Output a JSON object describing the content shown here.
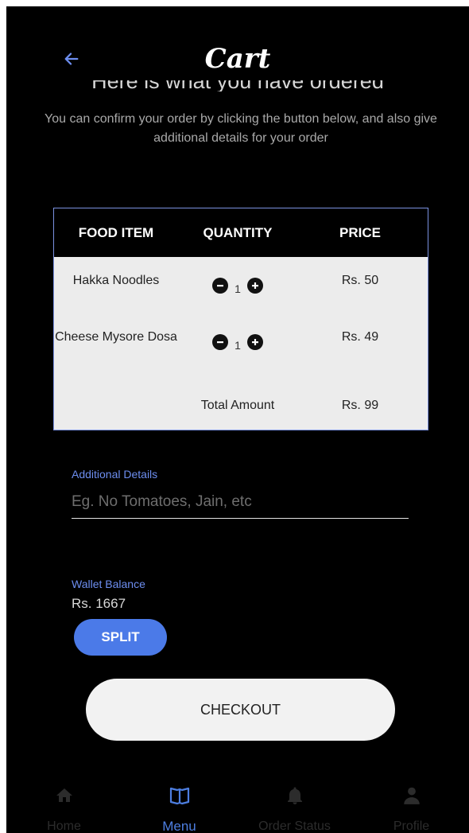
{
  "header": {
    "title": "Cart",
    "back_icon": "arrow-left-icon",
    "heading": "Here is what you have ordered",
    "subtitle": "You can confirm your order by clicking the button below, and also give additional details for your order"
  },
  "table": {
    "columns": [
      "FOOD ITEM",
      "QUANTITY",
      "PRICE"
    ],
    "rows": [
      {
        "name": "Hakka Noodles",
        "quantity": "1",
        "price": "Rs. 50"
      },
      {
        "name": "Cheese Mysore Dosa",
        "quantity": "1",
        "price": "Rs. 49"
      }
    ],
    "total_label": "Total Amount",
    "total_value": "Rs. 99"
  },
  "details": {
    "label": "Additional Details",
    "value": "",
    "placeholder": "Eg. No Tomatoes, Jain, etc"
  },
  "wallet": {
    "label": "Wallet Balance",
    "value": "Rs. 1667"
  },
  "buttons": {
    "split": "SPLIT",
    "checkout": "CHECKOUT"
  },
  "nav": {
    "items": [
      {
        "label": "Home",
        "icon": "home-icon",
        "active": false
      },
      {
        "label": "Menu",
        "icon": "book-icon",
        "active": true
      },
      {
        "label": "Order Status",
        "icon": "bell-icon",
        "active": false
      },
      {
        "label": "Profile",
        "icon": "person-icon",
        "active": false
      }
    ]
  },
  "colors": {
    "background": "#000000",
    "accent": "#4b7ae8",
    "table_background": "#ececec",
    "inactive_nav": "#2c2c2c"
  }
}
